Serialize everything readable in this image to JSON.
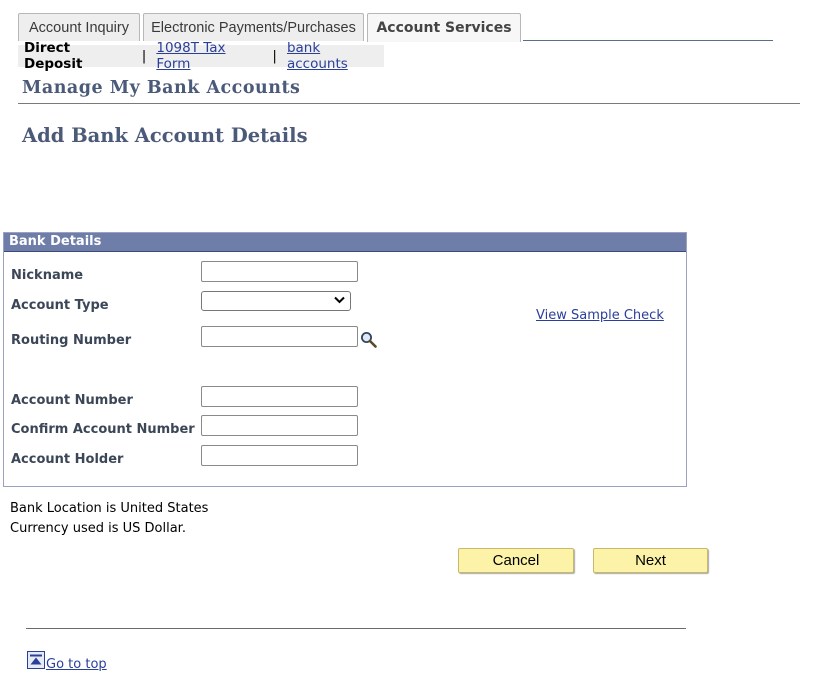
{
  "tabs": [
    {
      "label": "Account Inquiry",
      "active": false
    },
    {
      "label": "Electronic Payments/Purchases",
      "active": false
    },
    {
      "label": "Account Services",
      "active": true
    }
  ],
  "subnav": {
    "current": "Direct Deposit",
    "separator": "|",
    "links": [
      "1098T Tax Form",
      "bank accounts"
    ]
  },
  "page": {
    "title": "Manage My Bank Accounts",
    "subtitle": "Add Bank Account Details"
  },
  "bank_details": {
    "header": "Bank Details",
    "fields": {
      "nickname": {
        "label": "Nickname",
        "value": ""
      },
      "account_type": {
        "label": "Account Type",
        "value": ""
      },
      "routing_number": {
        "label": "Routing Number",
        "value": ""
      },
      "account_number": {
        "label": "Account Number",
        "value": ""
      },
      "confirm_account_number": {
        "label": "Confirm Account Number",
        "value": ""
      },
      "account_holder": {
        "label": "Account Holder",
        "value": ""
      }
    },
    "sample_check_link": "View Sample Check"
  },
  "info": {
    "bank_location": "Bank Location is United States",
    "currency": "Currency used is US Dollar."
  },
  "buttons": {
    "cancel": "Cancel",
    "next": "Next"
  },
  "footer": {
    "go_to_top": "Go to top"
  },
  "icons": {
    "lookup": "magnifier-icon",
    "go_to_top": "go-to-top-icon",
    "dropdown": "chevron-down-icon"
  },
  "colors": {
    "group_header": "#6f7ea9",
    "heading": "#4a5a78",
    "link": "#2a3f9a",
    "button": "#fdf3a8"
  }
}
